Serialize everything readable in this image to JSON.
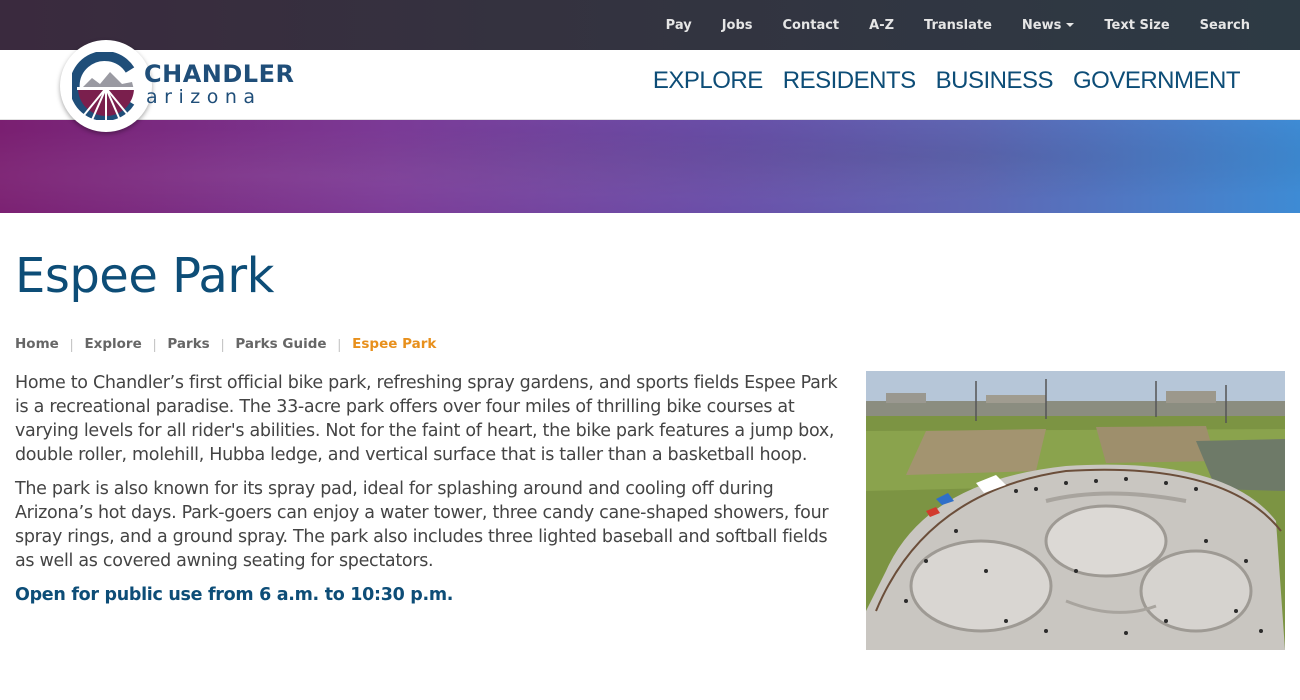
{
  "utility_nav": [
    {
      "label": "Pay"
    },
    {
      "label": "Jobs"
    },
    {
      "label": "Contact"
    },
    {
      "label": "A-Z"
    },
    {
      "label": "Translate"
    },
    {
      "label": "News",
      "has_dropdown": true
    },
    {
      "label": "Text Size"
    },
    {
      "label": "Search"
    }
  ],
  "logo": {
    "line1": "CHANDLER",
    "line2": "arizona"
  },
  "main_nav": [
    {
      "label": "EXPLORE"
    },
    {
      "label": "RESIDENTS"
    },
    {
      "label": "BUSINESS"
    },
    {
      "label": "GOVERNMENT"
    }
  ],
  "page": {
    "title": "Espee Park"
  },
  "breadcrumb": [
    {
      "label": "Home"
    },
    {
      "label": "Explore"
    },
    {
      "label": "Parks"
    },
    {
      "label": "Parks Guide"
    },
    {
      "label": "Espee Park",
      "current": true
    }
  ],
  "content": {
    "paragraph1": "Home to Chandler’s first official bike park, refreshing spray gardens, and sports fields Espee Park is a recreational paradise. The 33-acre park offers over four miles of thrilling bike courses at varying levels for all rider's abilities. Not for the faint of heart, the bike park features a jump box, double roller, molehill, Hubba ledge, and vertical surface that is taller than a basketball hoop.",
    "paragraph2": "The park is also known for its spray pad, ideal for splashing around and cooling off during Arizona’s hot days. Park-goers can enjoy a water tower, three candy cane-shaped showers, four spray rings, and a ground spray. The park also includes three lighted baseball and softball fields as well as covered awning seating for spectators.",
    "hours": "Open for public use from 6 a.m. to 10:30 p.m."
  },
  "colors": {
    "brand_blue": "#0d4d77",
    "accent_orange": "#e8901c",
    "logo_maroon": "#7a1f4d"
  }
}
